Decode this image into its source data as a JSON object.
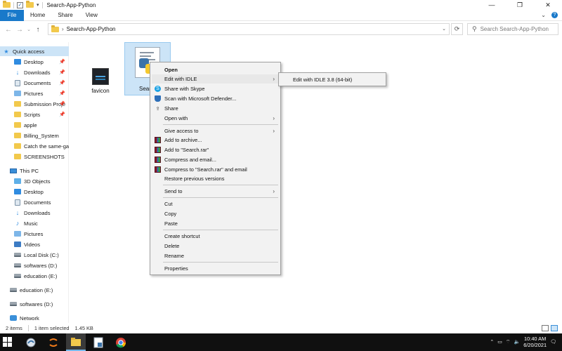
{
  "window": {
    "title": "Search-App-Python",
    "controls": {
      "minimize": "—",
      "maximize": "❐",
      "close": "✕"
    }
  },
  "ribbon": {
    "file": "File",
    "tabs": [
      "Home",
      "Share",
      "View"
    ]
  },
  "address": {
    "separator": "›",
    "path": "Search-App-Python",
    "search_placeholder": "Search Search-App-Python"
  },
  "sidebar": {
    "items": [
      {
        "label": "Quick access",
        "icon": "star-icon",
        "pinned": false,
        "selected": true
      },
      {
        "label": "Desktop",
        "icon": "desktop-icon",
        "pinned": true
      },
      {
        "label": "Downloads",
        "icon": "downloads-icon",
        "pinned": true
      },
      {
        "label": "Documents",
        "icon": "documents-icon",
        "pinned": true
      },
      {
        "label": "Pictures",
        "icon": "pictures-icon",
        "pinned": true
      },
      {
        "label": "Submission Proje",
        "icon": "folder-icon",
        "pinned": true
      },
      {
        "label": "Scripts",
        "icon": "folder-icon",
        "pinned": true
      },
      {
        "label": "apple",
        "icon": "folder-icon",
        "pinned": false
      },
      {
        "label": "Billing_System",
        "icon": "folder-icon",
        "pinned": false
      },
      {
        "label": "Catch the same-gar",
        "icon": "folder-icon",
        "pinned": false
      },
      {
        "label": "SCREENSHOTS",
        "icon": "folder-icon",
        "pinned": false
      },
      {
        "label": "This PC",
        "icon": "pc-icon",
        "pinned": false
      },
      {
        "label": "3D Objects",
        "icon": "3d-objects-icon",
        "pinned": false
      },
      {
        "label": "Desktop",
        "icon": "desktop-icon",
        "pinned": false
      },
      {
        "label": "Documents",
        "icon": "documents-icon",
        "pinned": false
      },
      {
        "label": "Downloads",
        "icon": "downloads-icon",
        "pinned": false
      },
      {
        "label": "Music",
        "icon": "music-icon",
        "pinned": false
      },
      {
        "label": "Pictures",
        "icon": "pictures-icon",
        "pinned": false
      },
      {
        "label": "Videos",
        "icon": "videos-icon",
        "pinned": false
      },
      {
        "label": "Local Disk (C:)",
        "icon": "drive-icon",
        "pinned": false
      },
      {
        "label": "softwares (D:)",
        "icon": "drive-icon",
        "pinned": false
      },
      {
        "label": "education (E:)",
        "icon": "drive-icon",
        "pinned": false
      },
      {
        "label": "education (E:)",
        "icon": "drive-icon",
        "pinned": false
      },
      {
        "label": "softwares (D:)",
        "icon": "drive-icon",
        "pinned": false
      },
      {
        "label": "Network",
        "icon": "network-icon",
        "pinned": false
      }
    ]
  },
  "files": {
    "favicon": "favicon",
    "selected_partial": "Sear"
  },
  "context_menu": {
    "open": "Open",
    "edit_idle": "Edit with IDLE",
    "share_skype": "Share with Skype",
    "scan_defender": "Scan with Microsoft Defender...",
    "share": "Share",
    "open_with": "Open with",
    "give_access": "Give access to",
    "add_archive": "Add to archive...",
    "add_rar": "Add to \"Search.rar\"",
    "compress_email": "Compress and email...",
    "compress_rar_email": "Compress to \"Search.rar\" and email",
    "restore": "Restore previous versions",
    "send_to": "Send to",
    "cut": "Cut",
    "copy": "Copy",
    "paste": "Paste",
    "create_shortcut": "Create shortcut",
    "delete": "Delete",
    "rename": "Rename",
    "properties": "Properties"
  },
  "submenu": {
    "edit_idle_38": "Edit with IDLE 3.8 (64-bit)"
  },
  "status": {
    "items": "2 items",
    "selected": "1 item selected",
    "size": "1.45 KB"
  },
  "taskbar": {
    "time": "10:40 AM",
    "date": "6/20/2021"
  },
  "colors": {
    "accent": "#1979ca",
    "selection": "#cce4f7",
    "menu_bg": "#f2f2f2",
    "taskbar": "#101010"
  }
}
